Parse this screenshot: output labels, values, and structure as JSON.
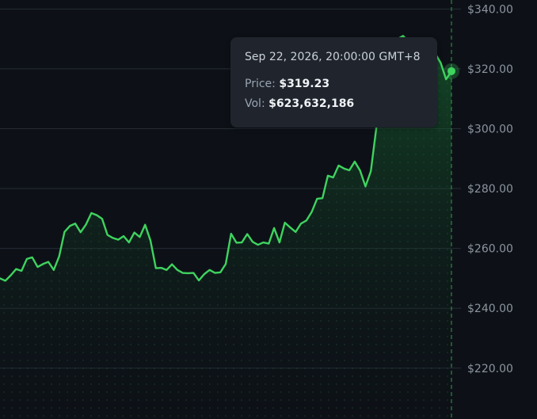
{
  "colors": {
    "background": "#0d1117",
    "line": "#3fd35f",
    "fill_top": "#1a7a36",
    "grid": "#262c36",
    "crosshair": "#2ea043",
    "axis_text": "#8b949e",
    "tooltip_bg": "#1f242d"
  },
  "tooltip": {
    "date": "Sep 22, 2026, 20:00:00 GMT+8",
    "price_label": "Price:",
    "price_value": "$319.23",
    "vol_label": "Vol:",
    "vol_value": "$623,632,186"
  },
  "chart_data": {
    "type": "area",
    "title": "",
    "xlabel": "",
    "ylabel": "",
    "ylim": [
      203,
      343
    ],
    "y_ticks": [
      {
        "value": 220,
        "label": "$220.00"
      },
      {
        "value": 240,
        "label": "$240.00"
      },
      {
        "value": 260,
        "label": "$260.00"
      },
      {
        "value": 280,
        "label": "$280.00"
      },
      {
        "value": 300,
        "label": "$300.00"
      },
      {
        "value": 320,
        "label": "$320.00"
      },
      {
        "value": 340,
        "label": "$340.00"
      }
    ],
    "grid": true,
    "axis_position": "right",
    "selected_index": 84,
    "series": [
      {
        "values": [
          250.0,
          249.2,
          251.0,
          253.1,
          252.5,
          256.5,
          257.0,
          253.8,
          254.8,
          255.5,
          252.8,
          257.3,
          265.5,
          267.5,
          268.3,
          265.4,
          268.0,
          271.8,
          271.1,
          269.9,
          264.5,
          263.5,
          262.9,
          264.1,
          262.0,
          265.3,
          263.8,
          267.9,
          262.6,
          253.4,
          253.5,
          252.8,
          254.7,
          252.8,
          251.8,
          251.7,
          251.8,
          249.3,
          251.4,
          252.8,
          251.8,
          252.0,
          254.8,
          264.9,
          261.9,
          262.0,
          264.8,
          262.2,
          261.2,
          262.0,
          261.6,
          266.8,
          262.0,
          268.6,
          267.0,
          265.5,
          268.3,
          269.3,
          272.2,
          276.6,
          276.8,
          284.3,
          283.7,
          287.7,
          286.7,
          286.1,
          289.0,
          286.0,
          280.7,
          285.8,
          300.0,
          320.0,
          325.0,
          327.0,
          330.0,
          331.0,
          329.0,
          326.0,
          328.0,
          330.0,
          328.0,
          325.0,
          322.0,
          316.5,
          319.23
        ]
      }
    ]
  }
}
